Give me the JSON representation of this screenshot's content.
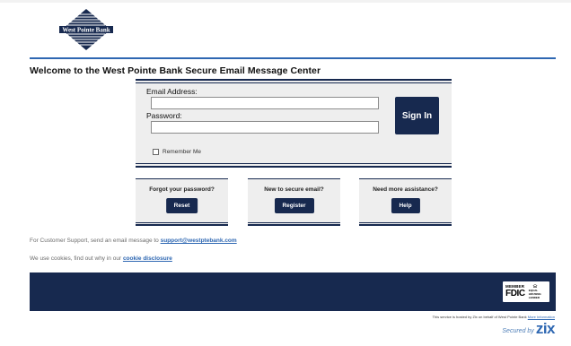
{
  "brand": {
    "logo_text": "West Pointe Bank",
    "colors": {
      "navy": "#17294f",
      "accent_blue": "#2e67b2",
      "panel_gray": "#eeeeee"
    }
  },
  "page": {
    "title": "Welcome to the West Pointe Bank Secure Email Message Center"
  },
  "login": {
    "email_label": "Email Address:",
    "email_value": "",
    "password_label": "Password:",
    "password_value": "",
    "remember_label": "Remember Me",
    "remember_checked": false,
    "signin_label": "Sign In"
  },
  "cards": [
    {
      "title": "Forgot your password?",
      "button": "Reset"
    },
    {
      "title": "New to secure email?",
      "button": "Register"
    },
    {
      "title": "Need more assistance?",
      "button": "Help"
    }
  ],
  "support": {
    "text": "For Customer Support, send an email message to ",
    "email": "support@westptebank.com"
  },
  "cookies": {
    "text": "We use cookies, find out why in our ",
    "link": "cookie disclosure"
  },
  "footer": {
    "fdic_member": "MEMBER",
    "fdic_name": "FDIC",
    "equal_housing": "EQUAL HOUSING LENDER",
    "hosted_text": "This service is hosted by Zix on behalf of West Pointe Bank ",
    "more_info": "More Information",
    "secured_by": "Secured by",
    "zix": "zix",
    "icons": [
      "fdic-logo",
      "equal-housing-icon",
      "zix-logo"
    ]
  }
}
